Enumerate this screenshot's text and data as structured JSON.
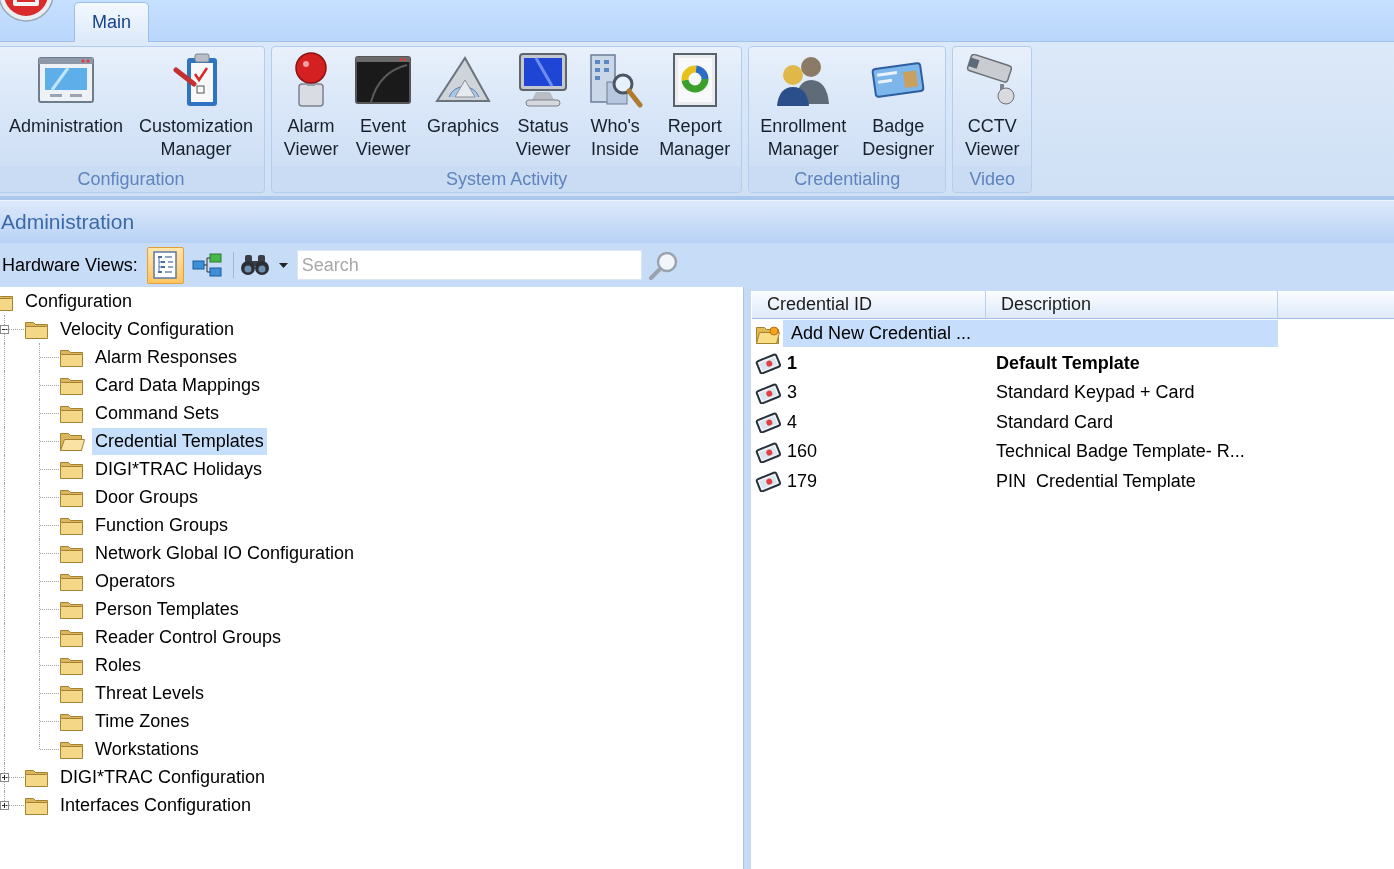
{
  "ribbon": {
    "tabs": [
      {
        "label": "Main",
        "selected": true
      }
    ],
    "groups": [
      {
        "label": "Configuration",
        "buttons": [
          {
            "label": "Administration"
          },
          {
            "label": "Customization Manager"
          }
        ]
      },
      {
        "label": "System Activity",
        "buttons": [
          {
            "label": "Alarm Viewer"
          },
          {
            "label": "Event Viewer"
          },
          {
            "label": "Graphics"
          },
          {
            "label": "Status Viewer"
          },
          {
            "label": "Who's Inside"
          },
          {
            "label": "Report Manager"
          }
        ]
      },
      {
        "label": "Credentialing",
        "buttons": [
          {
            "label": "Enrollment Manager"
          },
          {
            "label": "Badge Designer"
          }
        ]
      },
      {
        "label": "Video",
        "buttons": [
          {
            "label": "CCTV Viewer"
          }
        ]
      }
    ]
  },
  "panel": {
    "title": "Administration"
  },
  "toolbar": {
    "label": "Hardware Views:",
    "views": [
      {
        "selected": true
      },
      {
        "selected": false
      }
    ],
    "search": {
      "placeholder": "Search"
    }
  },
  "tree": [
    {
      "label": "Configuration",
      "selected": false,
      "children": [
        {
          "label": "Velocity Configuration",
          "expanded": true,
          "selected": false,
          "children": [
            {
              "label": "Alarm Responses",
              "selected": false
            },
            {
              "label": "Card Data Mappings",
              "selected": false
            },
            {
              "label": "Command Sets",
              "selected": false
            },
            {
              "label": "Credential Templates",
              "selected": true
            },
            {
              "label": "DIGI*TRAC Holidays",
              "selected": false
            },
            {
              "label": "Door Groups",
              "selected": false
            },
            {
              "label": "Function Groups",
              "selected": false
            },
            {
              "label": "Network Global IO Configuration",
              "selected": false
            },
            {
              "label": "Operators",
              "selected": false
            },
            {
              "label": "Person Templates",
              "selected": false
            },
            {
              "label": "Reader Control Groups",
              "selected": false
            },
            {
              "label": "Roles",
              "selected": false
            },
            {
              "label": "Threat Levels",
              "selected": false
            },
            {
              "label": "Time Zones",
              "selected": false
            },
            {
              "label": "Workstations",
              "selected": false
            }
          ]
        },
        {
          "label": "DIGI*TRAC Configuration",
          "expanded": false,
          "selected": false
        },
        {
          "label": "Interfaces Configuration",
          "expanded": false,
          "selected": false
        }
      ]
    }
  ],
  "table": {
    "columns": [
      "Credential ID",
      "Description"
    ],
    "rows": [
      {
        "kind": "add",
        "label": "Add New Credential ...",
        "selected": true
      },
      {
        "kind": "credential",
        "credential_id": "1",
        "description": "Default Template",
        "is_default": true,
        "selected": false
      },
      {
        "kind": "credential",
        "credential_id": "3",
        "description": "Standard Keypad + Card",
        "is_default": false,
        "selected": false
      },
      {
        "kind": "credential",
        "credential_id": "4",
        "description": "Standard Card",
        "is_default": false,
        "selected": false
      },
      {
        "kind": "credential",
        "credential_id": "160",
        "description": "Technical Badge Template- R...",
        "is_default": false,
        "selected": false
      },
      {
        "kind": "credential",
        "credential_id": "179",
        "description": "PIN  Credential Template",
        "is_default": false,
        "selected": false
      }
    ]
  }
}
